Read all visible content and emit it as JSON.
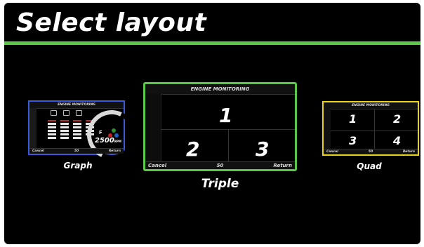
{
  "header": {
    "title": "Select layout"
  },
  "layouts": {
    "graph": {
      "caption": "Graph",
      "screen_title": "ENGINE MONITORING",
      "rpm_value": "2500",
      "rpm_unit": "RPM",
      "gear": "F",
      "footer": {
        "left": "Cancel",
        "center": "50",
        "right": "Return"
      },
      "border_color": "#3a5ad6"
    },
    "triple": {
      "caption": "Triple",
      "screen_title": "ENGINE MONITORING",
      "panels": [
        "1",
        "2",
        "3"
      ],
      "footer": {
        "left": "Cancel",
        "center": "50",
        "right": "Return"
      },
      "border_color": "#5cc84a"
    },
    "quad": {
      "caption": "Quad",
      "screen_title": "ENGINE MONITORING",
      "panels": [
        "1",
        "2",
        "3",
        "4"
      ],
      "footer": {
        "left": "Cancel",
        "center": "50",
        "right": "Return"
      },
      "border_color": "#e8d21e"
    }
  },
  "accent_color": "#5cc84a"
}
